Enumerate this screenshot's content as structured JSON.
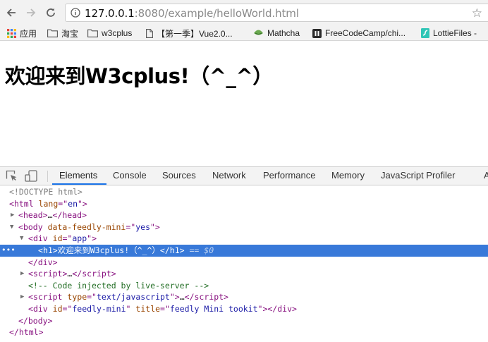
{
  "browser": {
    "url_host": "127.0.0.1",
    "url_rest": ":8080/example/helloWorld.html"
  },
  "bookmarks": [
    {
      "label": "应用",
      "icon": "apps-grid-icon"
    },
    {
      "label": "淘宝",
      "icon": "folder-icon"
    },
    {
      "label": "w3cplus",
      "icon": "folder-icon"
    },
    {
      "label": "【第一季】Vue2.0...",
      "icon": "page-icon"
    },
    {
      "label": "Mathcha",
      "icon": "mathcha-logo-icon"
    },
    {
      "label": "FreeCodeCamp/chi...",
      "icon": "github-icon"
    },
    {
      "label": "LottieFiles -",
      "icon": "lottie-icon"
    }
  ],
  "page": {
    "heading": "欢迎来到W3cplus!（^_^）"
  },
  "devtools": {
    "tabs": [
      "Elements",
      "Console",
      "Sources",
      "Network",
      "Performance",
      "Memory",
      "JavaScript Profiler",
      "A"
    ],
    "active_tab": "Elements",
    "dom": {
      "doctype": "<!DOCTYPE html>",
      "html_tag": "html",
      "lang_attr": "lang",
      "lang_val": "en",
      "head": "head",
      "ellipsis": "…",
      "body_tag": "body",
      "feedly_attr": "data-feedly-mini",
      "feedly_val": "yes",
      "div_tag": "div",
      "id_attr": "id",
      "app_val": "app",
      "h1_tag": "h1",
      "h1_text": "欢迎来到W3cplus!（^_^）",
      "eq0": "== $0",
      "script_tag": "script",
      "comment": "<!-- Code injected by live-server -->",
      "type_attr": "type",
      "type_val": "text/javascript",
      "feedly_id_val": "feedly-mini",
      "title_attr": "title",
      "title_val": "feedly Mini tookit"
    }
  }
}
